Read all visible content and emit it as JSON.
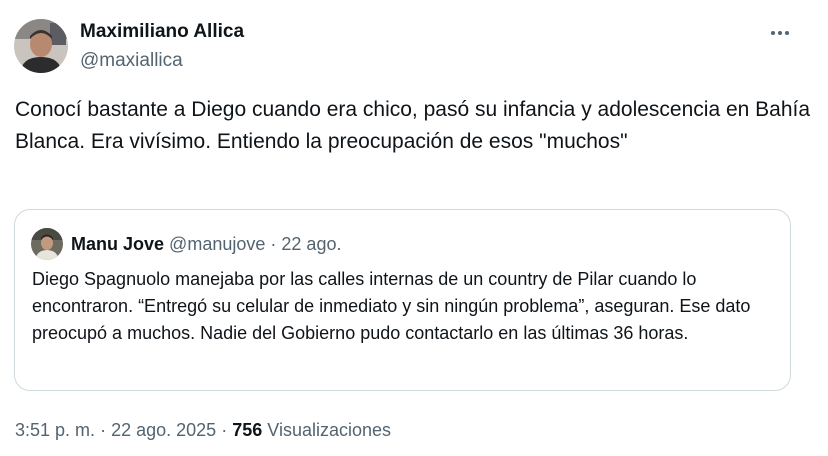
{
  "author": {
    "name": "Maximiliano Allica",
    "handle": "@maxiallica"
  },
  "tweet": {
    "text": "Conocí bastante a Diego cuando era chico, pasó su infancia y adolescencia en Bahía Blanca. Era vivísimo. Entiendo la preocupación de esos \"muchos\""
  },
  "quote": {
    "name": "Manu Jove",
    "handle": "@manujove",
    "separator": "·",
    "date": "22 ago.",
    "text": "Diego Spagnuolo manejaba por las calles internas de un country de Pilar cuando lo encontraron. “Entregó su celular de inmediato y sin ningún problema”, aseguran. Ese dato preocupó a muchos. Nadie del Gobierno pudo contactarlo en las últimas 36 horas."
  },
  "footer": {
    "time": "3:51 p. m.",
    "separator": "·",
    "date": "22 ago. 2025",
    "views_count": "756",
    "views_label": "Visualizaciones"
  },
  "icons": {
    "more": "more-horizontal-icon"
  },
  "colors": {
    "text": "#0f1419",
    "secondary": "#536471",
    "border": "#cfd9de"
  }
}
